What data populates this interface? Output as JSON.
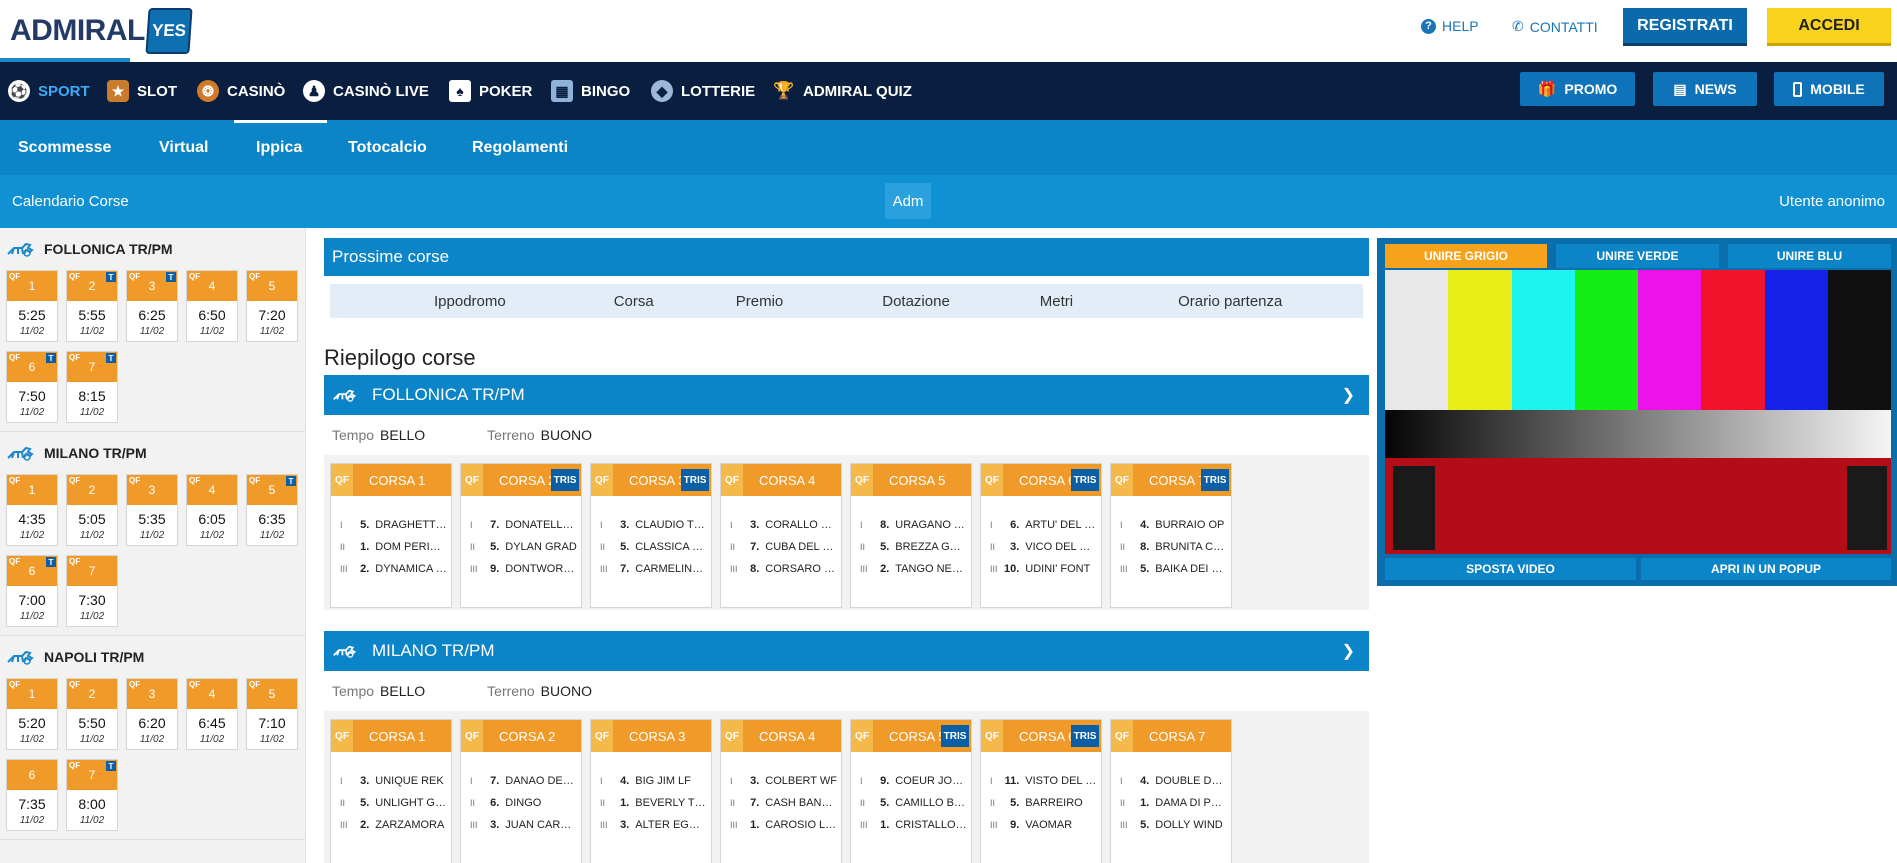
{
  "header": {
    "logo_text": "ADMIRAL",
    "logo_badge": "YES",
    "help": "HELP",
    "contatti": "CONTATTI",
    "registrati": "REGISTRATI",
    "accedi": "ACCEDI"
  },
  "main_nav": {
    "items": [
      {
        "label": "SPORT",
        "icon": "soccer-ball-icon",
        "active": true
      },
      {
        "label": "SLOT",
        "icon": "slot-machine-icon"
      },
      {
        "label": "CASINÒ",
        "icon": "roulette-icon"
      },
      {
        "label": "CASINÒ LIVE",
        "icon": "dealer-icon"
      },
      {
        "label": "POKER",
        "icon": "cards-icon"
      },
      {
        "label": "BINGO",
        "icon": "bingo-icon"
      },
      {
        "label": "LOTTERIE",
        "icon": "lottery-icon"
      },
      {
        "label": "ADMIRAL QUIZ",
        "icon": "trophy-icon"
      }
    ],
    "buttons": [
      {
        "label": "PROMO",
        "icon": "gift-icon"
      },
      {
        "label": "NEWS",
        "icon": "calendar-icon"
      },
      {
        "label": "MOBILE",
        "icon": "phone-icon"
      }
    ]
  },
  "sub_nav": {
    "items": [
      "Scommesse",
      "Virtual",
      "Ippica",
      "Totocalcio",
      "Regolamenti"
    ],
    "active": "Ippica"
  },
  "cal_bar": {
    "left": "Calendario Corse",
    "middle": "Adm",
    "right": "Utente anonimo"
  },
  "sidebar": {
    "venues": [
      {
        "name": "FOLLONICA TR/PM",
        "races": [
          {
            "n": "1",
            "qf": "QF",
            "t": false,
            "time": "5:25",
            "date": "11/02"
          },
          {
            "n": "2",
            "qf": "QF",
            "t": true,
            "time": "5:55",
            "date": "11/02"
          },
          {
            "n": "3",
            "qf": "QF",
            "t": true,
            "time": "6:25",
            "date": "11/02"
          },
          {
            "n": "4",
            "qf": "QF",
            "t": false,
            "time": "6:50",
            "date": "11/02"
          },
          {
            "n": "5",
            "qf": "QF",
            "t": false,
            "time": "7:20",
            "date": "11/02"
          },
          {
            "n": "6",
            "qf": "QF",
            "t": true,
            "time": "7:50",
            "date": "11/02"
          },
          {
            "n": "7",
            "qf": "QF",
            "t": true,
            "time": "8:15",
            "date": "11/02"
          }
        ]
      },
      {
        "name": "MILANO TR/PM",
        "races": [
          {
            "n": "1",
            "qf": "QF",
            "t": false,
            "time": "4:35",
            "date": "11/02"
          },
          {
            "n": "2",
            "qf": "QF",
            "t": false,
            "time": "5:05",
            "date": "11/02"
          },
          {
            "n": "3",
            "qf": "QF",
            "t": false,
            "time": "5:35",
            "date": "11/02"
          },
          {
            "n": "4",
            "qf": "QF",
            "t": false,
            "time": "6:05",
            "date": "11/02"
          },
          {
            "n": "5",
            "qf": "QF",
            "t": true,
            "time": "6:35",
            "date": "11/02"
          },
          {
            "n": "6",
            "qf": "QF",
            "t": true,
            "time": "7:00",
            "date": "11/02"
          },
          {
            "n": "7",
            "qf": "QF",
            "t": false,
            "time": "7:30",
            "date": "11/02"
          }
        ]
      },
      {
        "name": "NAPOLI TR/PM",
        "races": [
          {
            "n": "1",
            "qf": "QF",
            "t": false,
            "time": "5:20",
            "date": "11/02"
          },
          {
            "n": "2",
            "qf": "QF",
            "t": false,
            "time": "5:50",
            "date": "11/02"
          },
          {
            "n": "3",
            "qf": "QF",
            "t": false,
            "time": "6:20",
            "date": "11/02"
          },
          {
            "n": "4",
            "qf": "QF",
            "t": false,
            "time": "6:45",
            "date": "11/02"
          },
          {
            "n": "5",
            "qf": "QF",
            "t": false,
            "time": "7:10",
            "date": "11/02"
          },
          {
            "n": "6",
            "qf": "",
            "t": false,
            "time": "7:35",
            "date": "11/02"
          },
          {
            "n": "7",
            "qf": "QF",
            "t": true,
            "time": "8:00",
            "date": "11/02"
          }
        ]
      }
    ]
  },
  "prossime": {
    "title": "Prossime corse",
    "columns": [
      "Ippodromo",
      "Corsa",
      "Premio",
      "Dotazione",
      "Metri",
      "Orario partenza"
    ]
  },
  "riepilogo": {
    "title": "Riepilogo corse",
    "tempo_label": "Tempo",
    "terreno_label": "Terreno",
    "blocks": [
      {
        "name": "FOLLONICA TR/PM",
        "tempo": "BELLO",
        "terreno": "BUONO",
        "corse": [
          {
            "label": "CORSA 1",
            "tris": false,
            "rows": [
              {
                "r": "I",
                "n": "5.",
                "name": "DRAGHETTO ..."
              },
              {
                "r": "II",
                "n": "1.",
                "name": "DOM PERIGN..."
              },
              {
                "r": "III",
                "n": "2.",
                "name": "DYNAMICA WI..."
              }
            ]
          },
          {
            "label": "CORSA 2",
            "tris": true,
            "rows": [
              {
                "r": "I",
                "n": "7.",
                "name": "DONATELLO ..."
              },
              {
                "r": "II",
                "n": "5.",
                "name": "DYLAN GRAD"
              },
              {
                "r": "III",
                "n": "9.",
                "name": "DONTWORRY..."
              }
            ]
          },
          {
            "label": "CORSA 3",
            "tris": true,
            "rows": [
              {
                "r": "I",
                "n": "3.",
                "name": "CLAUDIO THOR"
              },
              {
                "r": "II",
                "n": "5.",
                "name": "CLASSICA MA..."
              },
              {
                "r": "III",
                "n": "7.",
                "name": "CARMELINA D..."
              }
            ]
          },
          {
            "label": "CORSA 4",
            "tris": false,
            "rows": [
              {
                "r": "I",
                "n": "3.",
                "name": "CORALLO PIS..."
              },
              {
                "r": "II",
                "n": "7.",
                "name": "CUBA DEL DU..."
              },
              {
                "r": "III",
                "n": "8.",
                "name": "CORSARO SAN"
              }
            ]
          },
          {
            "label": "CORSA 5",
            "tris": false,
            "rows": [
              {
                "r": "I",
                "n": "8.",
                "name": "URAGANO TR..."
              },
              {
                "r": "II",
                "n": "5.",
                "name": "BREZZA GRAD"
              },
              {
                "r": "III",
                "n": "2.",
                "name": "TANGO NEGRO"
              }
            ]
          },
          {
            "label": "CORSA 6",
            "tris": true,
            "rows": [
              {
                "r": "I",
                "n": "6.",
                "name": "ARTU' DEL BR..."
              },
              {
                "r": "II",
                "n": "3.",
                "name": "VICO DEL RO..."
              },
              {
                "r": "III",
                "n": "10.",
                "name": "UDINI' FONT"
              }
            ]
          },
          {
            "label": "CORSA 7",
            "tris": true,
            "rows": [
              {
                "r": "I",
                "n": "4.",
                "name": "BURRAIO OP"
              },
              {
                "r": "II",
                "n": "8.",
                "name": "BRUNITA CAF"
              },
              {
                "r": "III",
                "n": "5.",
                "name": "BAIKA DEI RO..."
              }
            ]
          }
        ]
      },
      {
        "name": "MILANO TR/PM",
        "tempo": "BELLO",
        "terreno": "BUONO",
        "corse": [
          {
            "label": "CORSA 1",
            "tris": false,
            "rows": [
              {
                "r": "I",
                "n": "3.",
                "name": "UNIQUE REK"
              },
              {
                "r": "II",
                "n": "5.",
                "name": "UNLIGHT GRIF"
              },
              {
                "r": "III",
                "n": "2.",
                "name": "ZARZAMORA"
              }
            ]
          },
          {
            "label": "CORSA 2",
            "tris": false,
            "rows": [
              {
                "r": "I",
                "n": "7.",
                "name": "DANAO DEGLI..."
              },
              {
                "r": "II",
                "n": "6.",
                "name": "DINGO"
              },
              {
                "r": "III",
                "n": "3.",
                "name": "JUAN CARLOS..."
              }
            ]
          },
          {
            "label": "CORSA 3",
            "tris": false,
            "rows": [
              {
                "r": "I",
                "n": "4.",
                "name": "BIG JIM LF"
              },
              {
                "r": "II",
                "n": "1.",
                "name": "BEVERLY TRIO"
              },
              {
                "r": "III",
                "n": "3.",
                "name": "ALTER EGO C..."
              }
            ]
          },
          {
            "label": "CORSA 4",
            "tris": false,
            "rows": [
              {
                "r": "I",
                "n": "3.",
                "name": "COLBERT WF"
              },
              {
                "r": "II",
                "n": "7.",
                "name": "CASH BANK B..."
              },
              {
                "r": "III",
                "n": "1.",
                "name": "CAROSIO LIG..."
              }
            ]
          },
          {
            "label": "CORSA 5",
            "tris": true,
            "rows": [
              {
                "r": "I",
                "n": "9.",
                "name": "COEUR JOYEU..."
              },
              {
                "r": "II",
                "n": "5.",
                "name": "CAMILLO BABA"
              },
              {
                "r": "III",
                "n": "1.",
                "name": "CRISTALLO ARC"
              }
            ]
          },
          {
            "label": "CORSA 6",
            "tris": true,
            "rows": [
              {
                "r": "I",
                "n": "11.",
                "name": "VISTO DEL N..."
              },
              {
                "r": "II",
                "n": "5.",
                "name": "BARREIRO"
              },
              {
                "r": "III",
                "n": "9.",
                "name": "VAOMAR"
              }
            ]
          },
          {
            "label": "CORSA 7",
            "tris": false,
            "rows": [
              {
                "r": "I",
                "n": "4.",
                "name": "DOUBLE DRE..."
              },
              {
                "r": "II",
                "n": "1.",
                "name": "DAMA DI PRU..."
              },
              {
                "r": "III",
                "n": "5.",
                "name": "DOLLY WIND"
              }
            ]
          }
        ]
      }
    ]
  },
  "video": {
    "tabs": [
      "UNIRE GRIGIO",
      "UNIRE VERDE",
      "UNIRE BLU"
    ],
    "active_tab": "UNIRE GRIGIO",
    "bar_colors": [
      "#e8e8e8",
      "#eaee18",
      "#1ef4ee",
      "#14ee14",
      "#ee12ea",
      "#f0132a",
      "#1621ea",
      "#101010"
    ],
    "buttons": [
      "SPOSTA VIDEO",
      "APRI IN UN POPUP"
    ]
  }
}
